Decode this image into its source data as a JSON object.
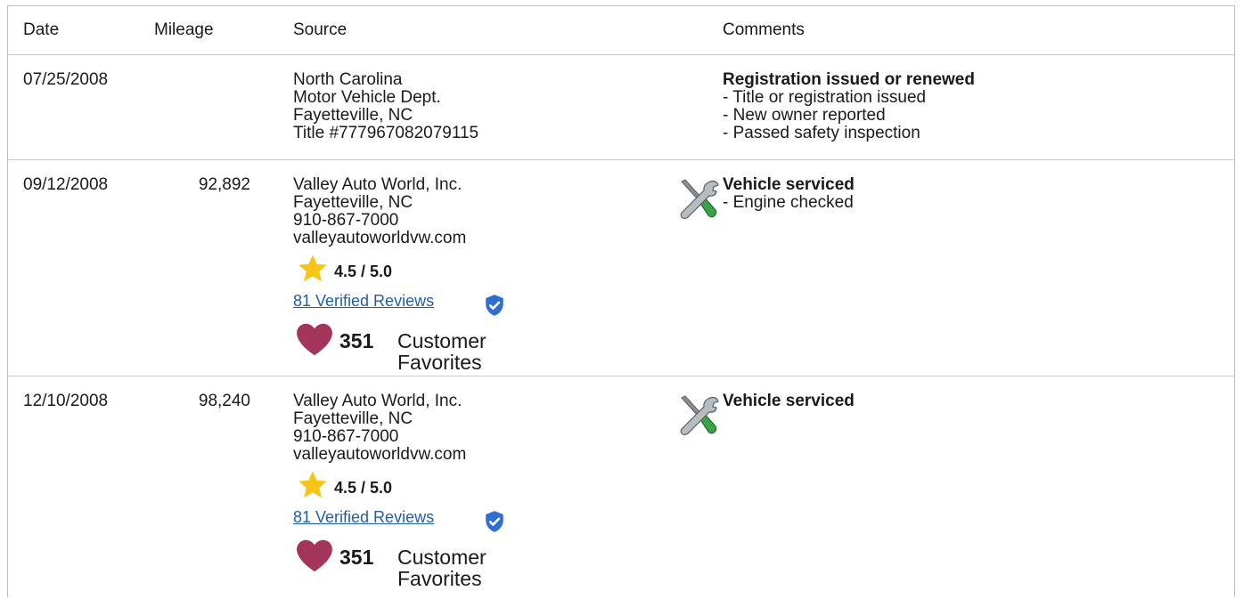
{
  "header": {
    "date": "Date",
    "mileage": "Mileage",
    "source": "Source",
    "comments": "Comments"
  },
  "rows": [
    {
      "date": "07/25/2008",
      "mileage": "",
      "source": [
        "North Carolina",
        "Motor Vehicle Dept.",
        "Fayetteville, NC",
        "Title #777967082079115"
      ],
      "comment_title": "Registration issued or renewed",
      "comment_items": [
        "- Title or registration issued",
        "- New owner reported",
        "- Passed safety inspection"
      ]
    },
    {
      "date": "09/12/2008",
      "mileage": "92,892",
      "source": [
        "Valley Auto World, Inc.",
        "Fayetteville, NC",
        "910-867-7000",
        "valleyautoworldvw.com"
      ],
      "rating": "4.5 / 5.0",
      "reviews": "81 Verified Reviews",
      "favorites_count": "351",
      "favorites_label": "Customer Favorites",
      "comment_icon": "service-tools-icon",
      "comment_title": "Vehicle serviced",
      "comment_items": [
        "- Engine checked"
      ]
    },
    {
      "date": "12/10/2008",
      "mileage": "98,240",
      "source": [
        "Valley Auto World, Inc.",
        "Fayetteville, NC",
        "910-867-7000",
        "valleyautoworldvw.com"
      ],
      "rating": "4.5 / 5.0",
      "reviews": "81 Verified Reviews",
      "favorites_count": "351",
      "favorites_label": "Customer Favorites",
      "comment_icon": "service-tools-icon",
      "comment_title": "Vehicle serviced",
      "comment_items": []
    }
  ],
  "colors": {
    "star": "#f5c518",
    "heart": "#a3345a",
    "verified_shield": "#2e6fd1",
    "link": "#1f5fa8"
  }
}
